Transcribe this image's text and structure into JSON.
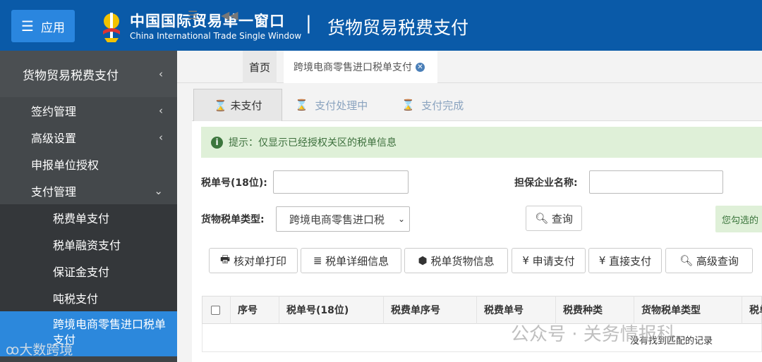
{
  "header": {
    "app_button": "应用",
    "brand_cn": "中国国际贸易单一窗口",
    "brand_en": "China International Trade Single Window",
    "separator": "|",
    "system_title": "货物贸易税费支付"
  },
  "sidebar": {
    "title": "货物贸易税费支付",
    "items": [
      {
        "label": "签约管理"
      },
      {
        "label": "高级设置"
      },
      {
        "label": "申报单位授权"
      },
      {
        "label": "支付管理"
      }
    ],
    "sub_items": [
      {
        "label": "税费单支付"
      },
      {
        "label": "税单融资支付"
      },
      {
        "label": "保证金支付"
      },
      {
        "label": "吨税支付"
      },
      {
        "label": "跨境电商零售进口税单支付"
      }
    ]
  },
  "tabbar": {
    "home": "首页",
    "active_tab": "跨境电商零售进口税单支付"
  },
  "subtabs": [
    {
      "label": "未支付"
    },
    {
      "label": "支付处理中"
    },
    {
      "label": "支付完成"
    }
  ],
  "notice": "提示：仅显示已经授权关区的税单信息",
  "form": {
    "tax_no_label": "税单号(18位):",
    "guarantor_label": "担保企业名称:",
    "type_label": "货物税单类型:",
    "type_value": "跨境电商零售进口税",
    "query": "查询",
    "hint": "您勾选的"
  },
  "actions": [
    "核对单打印",
    "税单详细信息",
    "税单货物信息",
    "申请支付",
    "直接支付",
    "高级查询"
  ],
  "table": {
    "headers": [
      "序号",
      "税单号(18位)",
      "税费单序号",
      "税费单号",
      "税费种类",
      "货物税单类型",
      "税单"
    ],
    "empty": "没有找到匹配的记录"
  },
  "watermarks": {
    "left": "大数跨境",
    "right": "公众号 · 关务情报科"
  }
}
